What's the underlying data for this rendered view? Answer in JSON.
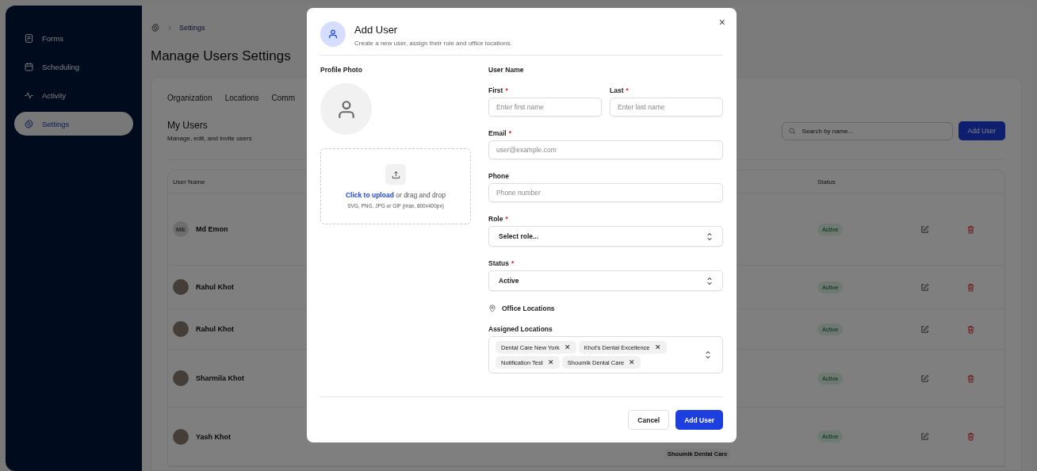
{
  "sidebar": {
    "items": [
      {
        "label": "Forms",
        "selected": false
      },
      {
        "label": "Scheduling",
        "selected": false
      },
      {
        "label": "Activity",
        "selected": false
      },
      {
        "label": "Settings",
        "selected": true
      }
    ]
  },
  "breadcrumb": {
    "current": "Settings"
  },
  "page_title": "Manage Users Settings",
  "tabs": [
    {
      "label": "Organization",
      "selected": false
    },
    {
      "label": "Locations",
      "selected": false
    },
    {
      "label": "Comm",
      "selected": false
    }
  ],
  "section": {
    "title": "My Users",
    "subtitle": "Manage, edit, and invite users"
  },
  "search": {
    "placeholder": "Search by name..."
  },
  "add_button": "Add User",
  "table": {
    "columns": [
      "User Name",
      "Status"
    ],
    "rows": [
      {
        "name": "Md Emon",
        "initials": "ME",
        "status": "Active"
      },
      {
        "name": "Rahul Khot",
        "status": "Active"
      },
      {
        "name": "Rahul Khot",
        "status": "Active"
      },
      {
        "name": "Sharmila Khot",
        "status": "Active"
      },
      {
        "name": "Yash Khot",
        "status": "Active",
        "location": "Shoumik Dental Care"
      }
    ]
  },
  "modal": {
    "title": "Add User",
    "subtitle": "Create a new user, assign their role and office locations.",
    "photo": {
      "label": "Profile Photo",
      "upload_link": "Click to upload",
      "upload_text": "or drag and drop",
      "upload_hint": "SVG, PNG, JPG or GIF (max. 800x400px)"
    },
    "user_name_label": "User Name",
    "name_fields": [
      {
        "label": "First",
        "required_mark": "*",
        "placeholder": "Enter first name"
      },
      {
        "label": "Last",
        "required_mark": "*",
        "placeholder": "Enter last name"
      }
    ],
    "fields": [
      {
        "kind": "input",
        "label": "Email",
        "required_mark": "*",
        "placeholder": "user@example.com"
      },
      {
        "kind": "input",
        "label": "Phone",
        "placeholder": "Phone number"
      },
      {
        "kind": "select",
        "label": "Role",
        "required_mark": "*",
        "value": "Select role..."
      },
      {
        "kind": "select",
        "label": "Status",
        "required_mark": "*",
        "value": "Active"
      }
    ],
    "locations_heading": "Office Locations",
    "assigned_label": "Assigned Locations",
    "assigned": [
      {
        "label": "Dental Care New York",
        "remove": "✕"
      },
      {
        "label": "Khot's Dental Excellence",
        "remove": "✕"
      },
      {
        "label": "Notification Test",
        "remove": "✕"
      },
      {
        "label": "Shoumik Dental Care",
        "remove": "✕"
      }
    ],
    "close": "×",
    "buttons": [
      {
        "kind": "secondary",
        "label": "Cancel"
      },
      {
        "kind": "primary",
        "label": "Add User"
      }
    ]
  }
}
